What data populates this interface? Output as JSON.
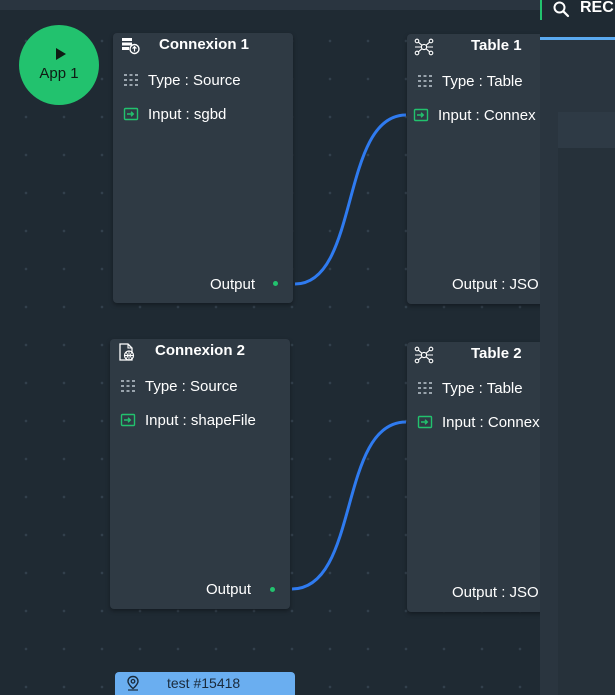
{
  "app": {
    "label": "App 1"
  },
  "nodes": {
    "connexion1": {
      "title": "Connexion 1",
      "type": "Type : Source",
      "input": "Input : sgbd",
      "output": "Output",
      "icon": "database-upload-icon"
    },
    "connexion2": {
      "title": "Connexion 2",
      "type": "Type : Source",
      "input": "Input : shapeFile",
      "output": "Output",
      "icon": "globe-file-icon"
    },
    "table1": {
      "title": "Table 1",
      "type": "Type : Table",
      "input": "Input : Connex",
      "output": "Output : JSO",
      "icon": "network-nodes-icon"
    },
    "table2": {
      "title": "Table 2",
      "type": "Type : Table",
      "input": "Input : Connex",
      "output": "Output : JSO",
      "icon": "network-nodes-icon"
    }
  },
  "right_panel": {
    "search_text": "REC",
    "icon": "search-icon"
  },
  "tag": {
    "label": "test #15418",
    "icon": "location-pin-icon"
  },
  "colors": {
    "canvas": "#1f2a33",
    "node": "#2f3a44",
    "accent_green": "#22c26e",
    "link_blue": "#2f7bf0",
    "tag_blue": "#6aaef0"
  }
}
